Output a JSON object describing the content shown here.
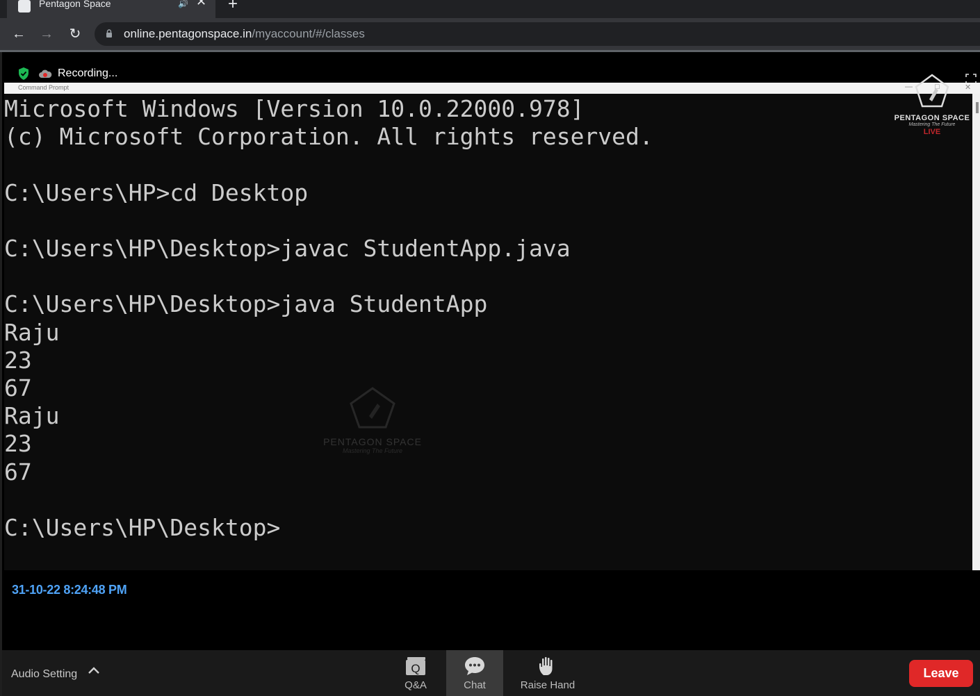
{
  "browser": {
    "tab_title": "Pentagon Space",
    "tab_audio_icon": "speaker-icon",
    "url_host": "online.pentagonspace.in",
    "url_path": "/myaccount/#/classes"
  },
  "meeting": {
    "recording_label": "Recording...",
    "timestamp": "31-10-22 8:24:48 PM"
  },
  "cmd": {
    "title": "Command Prompt",
    "lines": [
      "Microsoft Windows [Version 10.0.22000.978]",
      "(c) Microsoft Corporation. All rights reserved.",
      "",
      "C:\\Users\\HP>cd Desktop",
      "",
      "C:\\Users\\HP\\Desktop>javac StudentApp.java",
      "",
      "C:\\Users\\HP\\Desktop>java StudentApp",
      "Raju",
      "23",
      "67",
      "Raju",
      "23",
      "67",
      "",
      "C:\\Users\\HP\\Desktop>"
    ]
  },
  "watermark": {
    "name": "PENTAGON SPACE",
    "tagline": "Mastering The Future"
  },
  "brand": {
    "name": "PENTAGON SPACE",
    "tagline": "Mastering The Future",
    "live": "LIVE"
  },
  "controls": {
    "audio_setting": "Audio Setting",
    "qa": "Q&A",
    "chat": "Chat",
    "raise_hand": "Raise Hand",
    "leave": "Leave"
  },
  "colors": {
    "leave": "#e02828",
    "timestamp": "#4fa3f7",
    "live": "#c0262b",
    "shield": "#1db954"
  }
}
